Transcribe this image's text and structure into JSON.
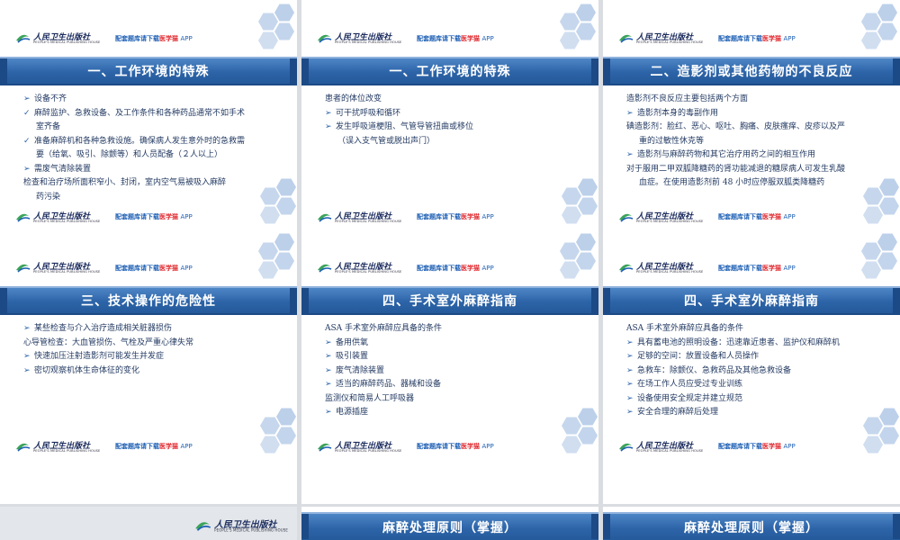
{
  "branding": {
    "logo_cn": "人民卫生出版社",
    "logo_en": "PEOPLE'S MEDICAL PUBLISHING HOUSE",
    "promo_prefix": "配套题库请下载",
    "promo_brand": "医学猫",
    "promo_suffix": "APP",
    "colors": {
      "title_bar": "#2d64a8",
      "text": "#243b63",
      "brand_red": "#e0262c",
      "hex": "#bcd0ea"
    }
  },
  "slides": [
    {
      "title": "一、工作环境的特殊",
      "lines": [
        {
          "mark": "➢",
          "text": "设备不齐"
        },
        {
          "mark": "✓",
          "text": "麻醉监护、急救设备、及工作条件和各种药品通常不如手术"
        },
        {
          "mark": "",
          "text": "室齐备",
          "indent": true
        },
        {
          "mark": "✓",
          "text": "准备麻醉机和各种急救设施。确保病人发生意外时的急救需"
        },
        {
          "mark": "",
          "text": "要（给氧、吸引、除颤等）和人员配备（２人以上）",
          "indent": true
        },
        {
          "mark": "➢",
          "text": "需废气清除装置"
        },
        {
          "mark": "",
          "text": "检查和治疗场所面积窄小、封闭，室内空气易被吸入麻醉"
        },
        {
          "mark": "",
          "text": "药污染",
          "indent": true
        }
      ]
    },
    {
      "title": "一、工作环境的特殊",
      "lines": [
        {
          "mark": "",
          "text": "患者的体位改变"
        },
        {
          "mark": "➢",
          "text": "可干扰呼吸和循环"
        },
        {
          "mark": "➢",
          "text": "发生呼吸道梗阻、气管导管扭曲或移位"
        },
        {
          "mark": "",
          "text": "（误入支气管或脱出声门）",
          "indent": true
        }
      ]
    },
    {
      "title": "二、造影剂或其他药物的不良反应",
      "lines": [
        {
          "mark": "",
          "text": "造影剂不良反应主要包括两个方面"
        },
        {
          "mark": "➢",
          "text": "造影剂本身的毒副作用"
        },
        {
          "mark": "",
          "text": "碘造影剂：脸红、恶心、呕吐、胸痛、皮肤瘙痒、皮疹以及严"
        },
        {
          "mark": "",
          "text": "重的过敏性休克等",
          "indent": true
        },
        {
          "mark": "➢",
          "text": "造影剂与麻醉药物和其它治疗用药之间的相互作用"
        },
        {
          "mark": "",
          "text": "对于服用二甲双胍降糖药的肾功能减退的糖尿病人可发生乳酸"
        },
        {
          "mark": "",
          "text": "血症。在使用造影剂前 48 小时应停服双胍类降糖药",
          "indent": true
        }
      ]
    },
    {
      "title": "三、技术操作的危险性",
      "lines": [
        {
          "mark": "➢",
          "text": "某些检查与介入治疗造成相关脏器损伤"
        },
        {
          "mark": "",
          "text": "心导管检查：大血管损伤、气栓及严重心律失常"
        },
        {
          "mark": "➢",
          "text": "快速加压注射造影剂可能发生并发症"
        },
        {
          "mark": "➢",
          "text": "密切观察机体生命体征的变化"
        }
      ]
    },
    {
      "title": "四、手术室外麻醉指南",
      "lines": [
        {
          "mark": "",
          "text": "ASA 手术室外麻醉应具备的条件"
        },
        {
          "mark": "➢",
          "text": "备用供氧"
        },
        {
          "mark": "➢",
          "text": "吸引装置"
        },
        {
          "mark": "➢",
          "text": "废气清除装置"
        },
        {
          "mark": "➢",
          "text": "适当的麻醉药品、器械和设备"
        },
        {
          "mark": "",
          "text": "监测仪和简易人工呼吸器"
        },
        {
          "mark": "➢",
          "text": "电源插座"
        }
      ]
    },
    {
      "title": "四、手术室外麻醉指南",
      "lines": [
        {
          "mark": "",
          "text": "ASA 手术室外麻醉应具备的条件"
        },
        {
          "mark": "➢",
          "text": "具有蓄电池的照明设备：迅速靠近患者、监护仪和麻醉机"
        },
        {
          "mark": "➢",
          "text": "足够的空间：放置设备和人员操作"
        },
        {
          "mark": "➢",
          "text": "急救车：除颤仪、急救药品及其他急救设备"
        },
        {
          "mark": "➢",
          "text": "在场工作人员应受过专业训练"
        },
        {
          "mark": "➢",
          "text": "设备使用安全规定并建立规范"
        },
        {
          "mark": "➢",
          "text": "安全合理的麻醉后处理"
        }
      ]
    },
    {
      "title": ""
    },
    {
      "title": "麻醉处理原则（掌握）"
    },
    {
      "title": "麻醉处理原则（掌握）"
    }
  ]
}
